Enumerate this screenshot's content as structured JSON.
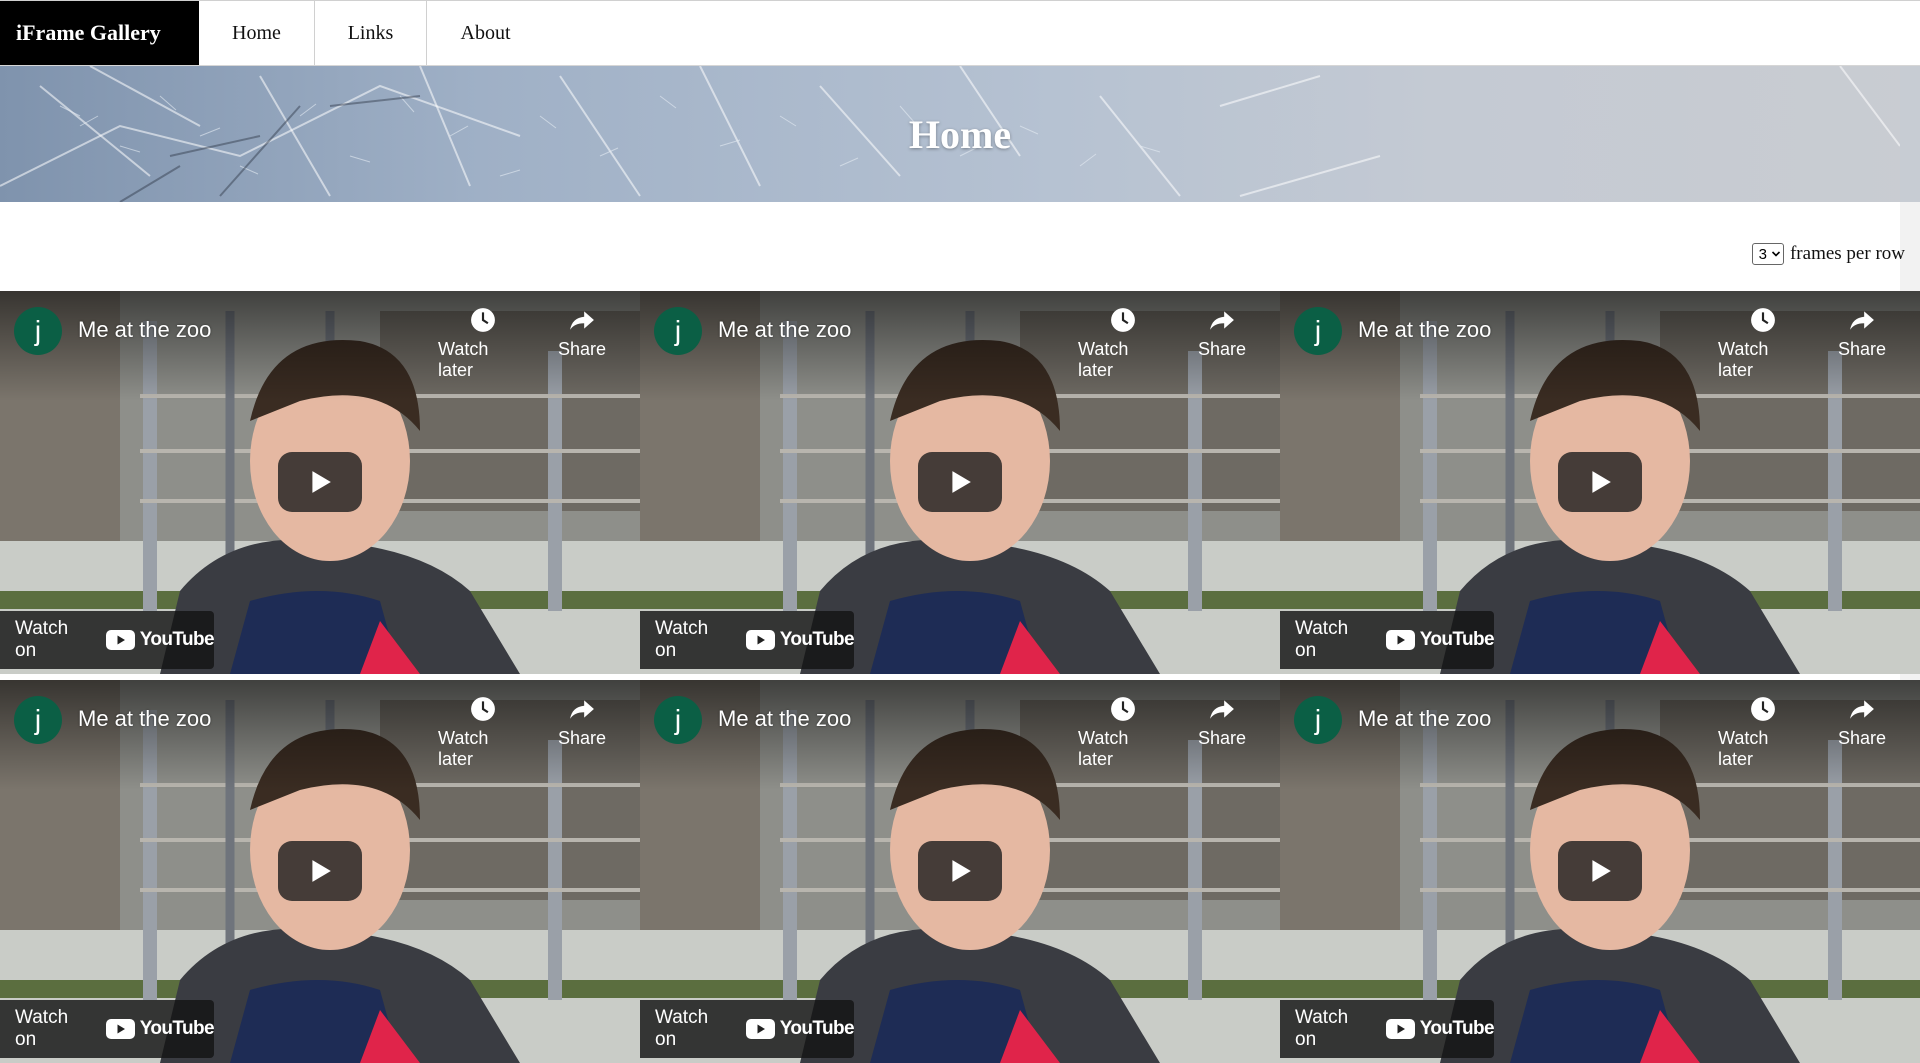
{
  "nav": {
    "brand": "iFrame Gallery",
    "links": [
      {
        "label": "Home"
      },
      {
        "label": "Links"
      },
      {
        "label": "About"
      }
    ]
  },
  "banner": {
    "title": "Home"
  },
  "controls": {
    "frames_per_row_value": "3",
    "frames_per_row_label": "frames per row",
    "chevron_icon": "chevron-down-icon"
  },
  "frame_template": {
    "channel_initial": "j",
    "title": "Me at the zoo",
    "watch_later_label": "Watch later",
    "share_label": "Share",
    "watch_on_label": "Watch on",
    "youtube_label": "YouTube"
  },
  "frames": [
    {
      "channel_initial": "j",
      "title": "Me at the zoo",
      "watch_later_label": "Watch later",
      "share_label": "Share",
      "watch_on_label": "Watch on",
      "youtube_label": "YouTube"
    },
    {
      "channel_initial": "j",
      "title": "Me at the zoo",
      "watch_later_label": "Watch later",
      "share_label": "Share",
      "watch_on_label": "Watch on",
      "youtube_label": "YouTube"
    },
    {
      "channel_initial": "j",
      "title": "Me at the zoo",
      "watch_later_label": "Watch later",
      "share_label": "Share",
      "watch_on_label": "Watch on",
      "youtube_label": "YouTube"
    },
    {
      "channel_initial": "j",
      "title": "Me at the zoo",
      "watch_later_label": "Watch later",
      "share_label": "Share",
      "watch_on_label": "Watch on",
      "youtube_label": "YouTube"
    },
    {
      "channel_initial": "j",
      "title": "Me at the zoo",
      "watch_later_label": "Watch later",
      "share_label": "Share",
      "watch_on_label": "Watch on",
      "youtube_label": "YouTube"
    },
    {
      "channel_initial": "j",
      "title": "Me at the zoo",
      "watch_later_label": "Watch later",
      "share_label": "Share",
      "watch_on_label": "Watch on",
      "youtube_label": "YouTube"
    }
  ],
  "colors": {
    "brand_bg": "#000000",
    "avatar_bg": "#0b5f45",
    "youtube_red": "#ff0000",
    "overlay_dark": "#212121"
  }
}
